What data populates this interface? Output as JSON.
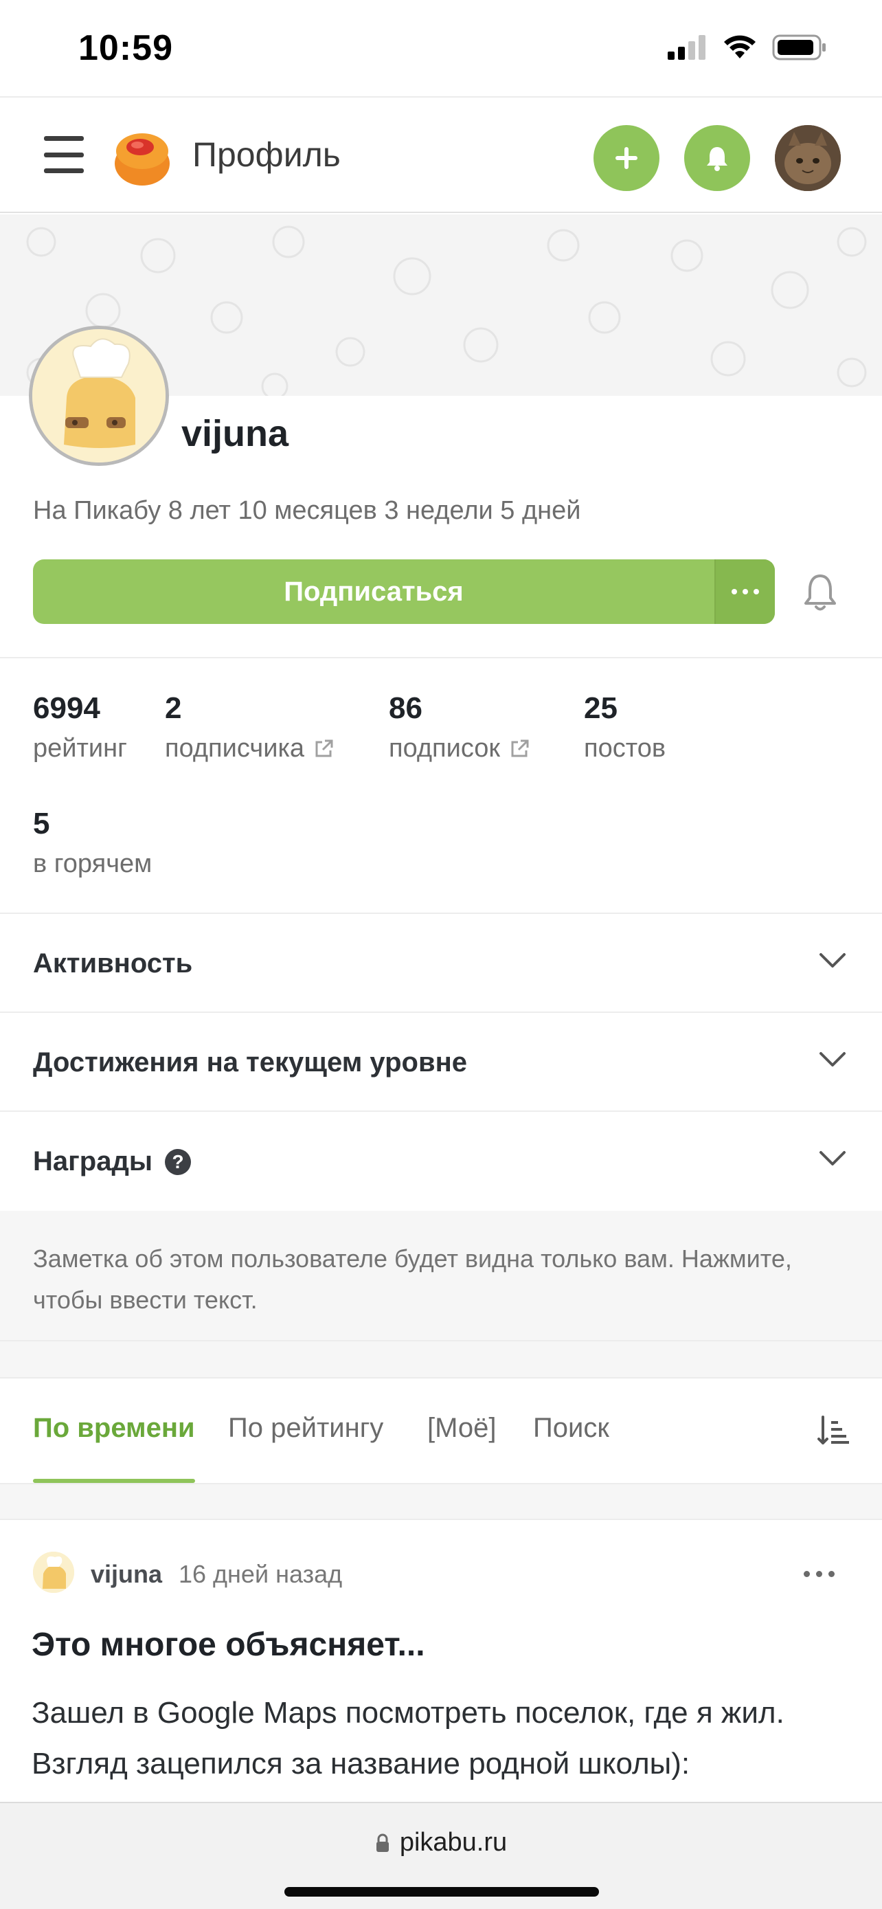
{
  "status_bar": {
    "time": "10:59",
    "icons": [
      "signal-icon",
      "wifi-icon",
      "battery-icon"
    ]
  },
  "header": {
    "title": "Профиль",
    "icons": [
      "menu-icon",
      "pikabu-logo",
      "plus-icon",
      "bell-icon",
      "user-avatar"
    ],
    "accent_color": "#8fc45a"
  },
  "profile": {
    "username": "vijuna",
    "since": "На Пикабу 8 лет 10 месяцев 3 недели 5 дней",
    "subscribe_label": "Подписаться"
  },
  "stats": [
    {
      "value": "6994",
      "label": "рейтинг"
    },
    {
      "value": "2",
      "label": "подписчика"
    },
    {
      "value": "86",
      "label": "подписок"
    },
    {
      "value": "25",
      "label": "постов"
    },
    {
      "value": "5",
      "label": "в горячем"
    }
  ],
  "sections": {
    "activity": "Активность",
    "achievements": "Достижения на текущем уровне",
    "awards": "Награды"
  },
  "note": {
    "text": "Заметка об этом пользователе будет видна только вам. Нажмите, чтобы ввести текст."
  },
  "tabs": {
    "by_time": "По времени",
    "by_rating": "По рейтингу",
    "mine": "[Моё]",
    "search": "Поиск"
  },
  "post": {
    "author": "vijuna",
    "time": "16 дней назад",
    "title": "Это многое объясняет...",
    "body": "Зашел в Google Maps посмотреть поселок, где я жил. Взгляд зацепился за название родной школы):"
  },
  "browser": {
    "url": "pikabu.ru"
  }
}
